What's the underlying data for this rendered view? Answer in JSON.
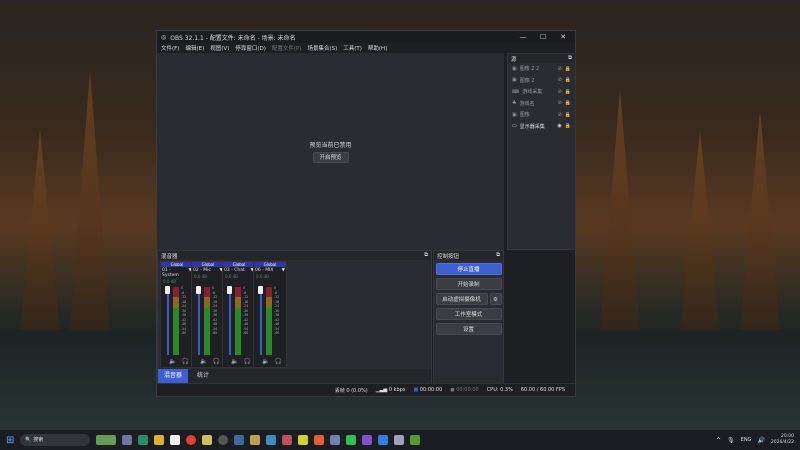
{
  "window": {
    "title": "OBS 32.1.1 - 配置文件: 未命名 - 场景: 未命名",
    "minimize": "—",
    "maximize": "☐",
    "close": "✕"
  },
  "menu": [
    "文件(F)",
    "编辑(E)",
    "视图(V)",
    "停靠窗口(D)",
    "配置文件(P)",
    "场景集合(S)",
    "工具(T)",
    "帮助(H)"
  ],
  "preview": {
    "message": "预览当前已禁用",
    "button": "开启预览"
  },
  "sources": {
    "title": "源",
    "items": [
      {
        "name": "图像 2 2",
        "icon": "image-icon",
        "visible": false
      },
      {
        "name": "图像 2",
        "icon": "image-icon",
        "visible": false
      },
      {
        "name": "游戏采集",
        "icon": "gamepad-icon",
        "visible": false
      },
      {
        "name": "游戏名",
        "icon": "text-icon",
        "visible": false
      },
      {
        "name": "图像",
        "icon": "image-icon",
        "visible": false
      },
      {
        "name": "显示器采集",
        "icon": "monitor-icon",
        "visible": true
      }
    ]
  },
  "mixer": {
    "title": "混音器",
    "channels": [
      {
        "group": "Global",
        "name": "01 - System",
        "db": "0.0 dB"
      },
      {
        "group": "Global",
        "name": "02 - Mic",
        "db": "0.0 dB"
      },
      {
        "group": "Global",
        "name": "03 - Chat",
        "db": "0.0 dB"
      },
      {
        "group": "Global",
        "name": "06 - MIX",
        "db": "0.0 dB"
      }
    ],
    "scale": [
      "0",
      "-6",
      "-12",
      "-18",
      "-24",
      "-30",
      "-36",
      "-42",
      "-48",
      "-54",
      "-60"
    ],
    "tabs": [
      "混音器",
      "统计"
    ]
  },
  "controls": {
    "title": "控制按钮",
    "stop_stream": "停止直播",
    "start_record": "开始录制",
    "virtual_cam": "启动虚拟摄像机",
    "studio_mode": "工作室模式",
    "settings": "设置",
    "accent": "#3d5fd1"
  },
  "status": {
    "dropped": "丢帧 0 (0.0%)",
    "bitrate": "0 kbps",
    "stream_time": "00:00:00",
    "record_time": "00:00:00",
    "cpu": "CPU: 0.3%",
    "fps": "60.00 / 60.00 FPS"
  },
  "taskbar": {
    "search": "搜索",
    "lang": "ENG",
    "time": "20:00",
    "date": "2026/4/22"
  }
}
